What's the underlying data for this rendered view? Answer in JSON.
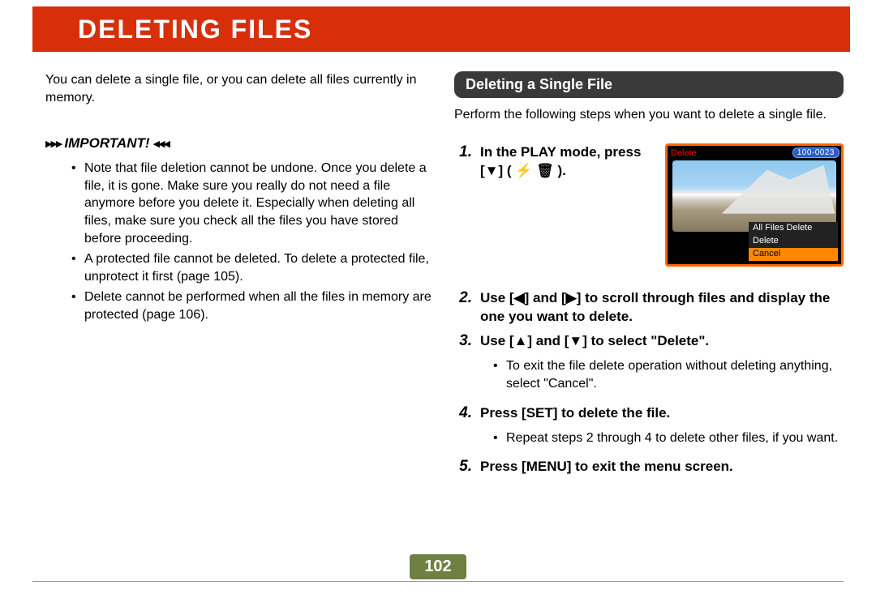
{
  "title": "DELETING FILES",
  "intro": "You can delete a single file, or you can delete all files currently in memory.",
  "important": {
    "label": "IMPORTANT!",
    "items": [
      "Note that file deletion cannot be undone. Once you delete a file, it is gone. Make sure you really do not need a file anymore before you delete it. Especially when deleting all files, make sure you check all the files you have stored before proceeding.",
      "A protected file cannot be deleted. To delete a protected file, unprotect it first (page 105).",
      "Delete cannot be performed when all the files in memory are protected (page 106)."
    ]
  },
  "section": {
    "header": "Deleting a Single File",
    "intro": "Perform the following steps when you want to delete a single file.",
    "steps": [
      {
        "num": "1.",
        "text": "In the PLAY mode, press [▼] ( ⚡ 🗑 ).",
        "hasImage": true
      },
      {
        "num": "2.",
        "text": "Use [◀] and [▶] to scroll through files and display the one you want to delete."
      },
      {
        "num": "3.",
        "text": "Use [▲] and [▼] to select \"Delete\".",
        "sub": [
          "To exit the file delete operation without deleting anything, select \"Cancel\"."
        ]
      },
      {
        "num": "4.",
        "text": "Press [SET] to delete the file.",
        "sub": [
          "Repeat steps 2 through 4 to delete other files, if you want."
        ]
      },
      {
        "num": "5.",
        "text": "Press [MENU] to exit the menu screen."
      }
    ]
  },
  "camera": {
    "deleteLabel": "Delete",
    "fileNum": "100-0023",
    "menu": {
      "allFiles": "All Files Delete",
      "delete": "Delete",
      "cancel": "Cancel"
    }
  },
  "pageNumber": "102"
}
